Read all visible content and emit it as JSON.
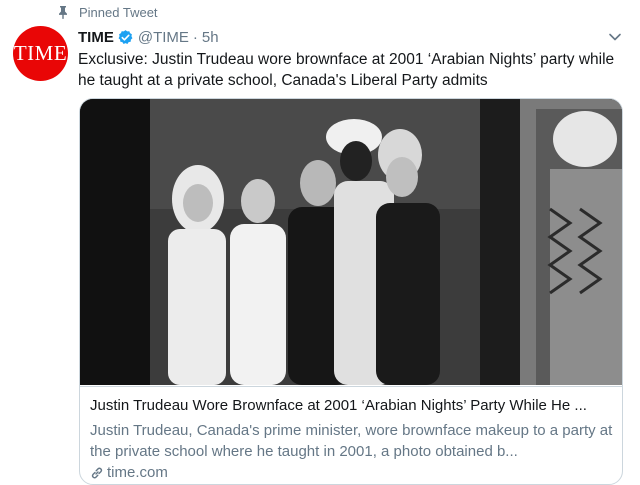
{
  "pinned": {
    "label": "Pinned Tweet",
    "icon": "pin-icon"
  },
  "author": {
    "avatar_text": "TIME",
    "name": "TIME",
    "handle": "@TIME",
    "separator": "·",
    "time": "5h",
    "verified_icon": "verified-badge-icon"
  },
  "tweet": {
    "text": "Exclusive: Justin Trudeau wore brownface at 2001 ‘Arabian Nights’ party while he taught at a private school, Canada's Liberal Party admits"
  },
  "card": {
    "image_alt": "Black-and-white party photo",
    "title": "Justin Trudeau Wore Brownface at 2001 ‘Arabian Nights’ Party While He ...",
    "description": "Justin Trudeau, Canada's prime minister, wore brownface makeup to a party at the private school where he taught in 2001, a photo obtained b...",
    "domain": "time.com",
    "domain_icon": "link-icon"
  },
  "colors": {
    "time_red": "#e90606",
    "twitter_blue": "#1da1f2",
    "secondary_text": "#657786",
    "border": "#ccd6dd"
  }
}
